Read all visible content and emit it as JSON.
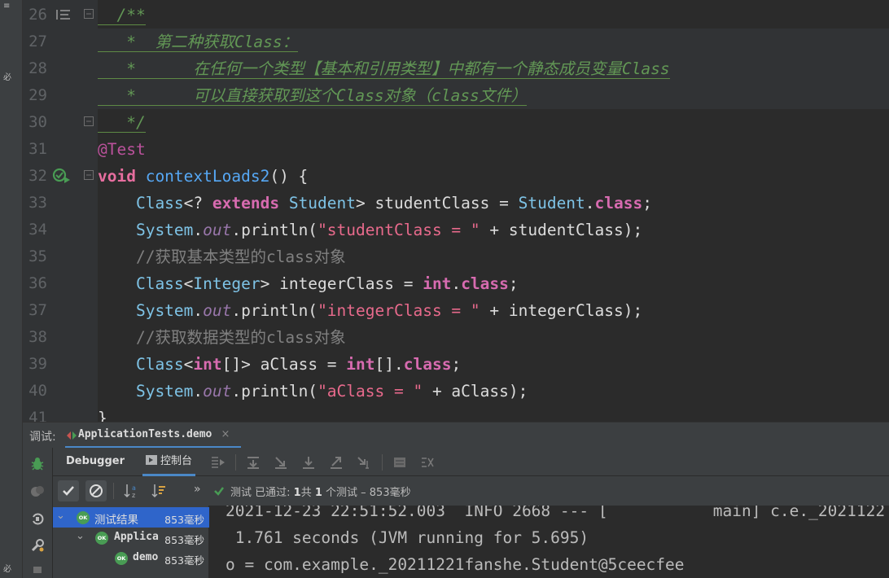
{
  "editor": {
    "lines": [
      {
        "num": "26",
        "segments": [
          {
            "t": "/**",
            "c": "c-doc"
          }
        ]
      },
      {
        "num": "27",
        "segments": [
          {
            "t": " *  第二种获取Class：",
            "c": "c-doc"
          }
        ]
      },
      {
        "num": "28",
        "segments": [
          {
            "t": " *      在任何一个类型【基本和引用类型】中都有一个静态成员变量Class",
            "c": "c-doc"
          }
        ]
      },
      {
        "num": "29",
        "segments": [
          {
            "t": " *      可以直接获取到这个Class对象（class文件）",
            "c": "c-doc"
          }
        ]
      },
      {
        "num": "30",
        "segments": [
          {
            "t": " */",
            "c": "c-doc"
          }
        ]
      },
      {
        "num": "31",
        "segments": [
          {
            "t": "@Test",
            "c": "c-ann"
          }
        ]
      },
      {
        "num": "32",
        "segments": [
          {
            "t": "void ",
            "c": "c-void"
          },
          {
            "t": "contextLoads2",
            "c": "c-method"
          },
          {
            "t": "() {",
            "c": "c-plain"
          }
        ]
      },
      {
        "num": "33",
        "segments": [
          {
            "t": "    Class",
            "c": "c-cls"
          },
          {
            "t": "<? ",
            "c": "c-plain"
          },
          {
            "t": "extends ",
            "c": "c-kwint"
          },
          {
            "t": "Student",
            "c": "c-cls"
          },
          {
            "t": "> studentClass = ",
            "c": "c-plain"
          },
          {
            "t": "Student",
            "c": "c-cls"
          },
          {
            "t": ".",
            "c": "c-plain"
          },
          {
            "t": "class",
            "c": "c-clsfield"
          },
          {
            "t": ";",
            "c": "c-plain"
          }
        ]
      },
      {
        "num": "34",
        "segments": [
          {
            "t": "    System",
            "c": "c-cls"
          },
          {
            "t": ".",
            "c": "c-plain"
          },
          {
            "t": "out",
            "c": "c-field"
          },
          {
            "t": ".println(",
            "c": "c-plain"
          },
          {
            "t": "\"studentClass = \"",
            "c": "c-str"
          },
          {
            "t": " + studentClass);",
            "c": "c-plain"
          }
        ]
      },
      {
        "num": "35",
        "segments": [
          {
            "t": "    //获取基本类型的class对象",
            "c": "c-cmt"
          }
        ]
      },
      {
        "num": "36",
        "segments": [
          {
            "t": "    Class",
            "c": "c-cls"
          },
          {
            "t": "<",
            "c": "c-plain"
          },
          {
            "t": "Integer",
            "c": "c-cls"
          },
          {
            "t": "> integerClass = ",
            "c": "c-plain"
          },
          {
            "t": "int",
            "c": "c-kwint"
          },
          {
            "t": ".",
            "c": "c-plain"
          },
          {
            "t": "class",
            "c": "c-clsfield"
          },
          {
            "t": ";",
            "c": "c-plain"
          }
        ]
      },
      {
        "num": "37",
        "segments": [
          {
            "t": "    System",
            "c": "c-cls"
          },
          {
            "t": ".",
            "c": "c-plain"
          },
          {
            "t": "out",
            "c": "c-field"
          },
          {
            "t": ".println(",
            "c": "c-plain"
          },
          {
            "t": "\"integerClass = \"",
            "c": "c-str"
          },
          {
            "t": " + integerClass);",
            "c": "c-plain"
          }
        ]
      },
      {
        "num": "38",
        "segments": [
          {
            "t": "    //获取数据类型的class对象",
            "c": "c-cmt"
          }
        ]
      },
      {
        "num": "39",
        "segments": [
          {
            "t": "    Class",
            "c": "c-cls"
          },
          {
            "t": "<",
            "c": "c-plain"
          },
          {
            "t": "int",
            "c": "c-kwint"
          },
          {
            "t": "[]> aClass = ",
            "c": "c-plain"
          },
          {
            "t": "int",
            "c": "c-kwint"
          },
          {
            "t": "[].",
            "c": "c-plain"
          },
          {
            "t": "class",
            "c": "c-clsfield"
          },
          {
            "t": ";",
            "c": "c-plain"
          }
        ]
      },
      {
        "num": "40",
        "segments": [
          {
            "t": "    System",
            "c": "c-cls"
          },
          {
            "t": ".",
            "c": "c-plain"
          },
          {
            "t": "out",
            "c": "c-field"
          },
          {
            "t": ".println(",
            "c": "c-plain"
          },
          {
            "t": "\"aClass = \"",
            "c": "c-str"
          },
          {
            "t": " + aClass);",
            "c": "c-plain"
          }
        ]
      },
      {
        "num": "41",
        "segments": [
          {
            "t": "}",
            "c": "c-plain"
          }
        ]
      }
    ]
  },
  "tool_window": {
    "title": "调试:",
    "tab_label": "ApplicationTests.demo",
    "tab_close": "×",
    "debugger_tab": "Debugger",
    "console_tab": "控制台"
  },
  "test_status": {
    "passed_prefix": "测试 已通过: ",
    "passed_count": "1",
    "middle": "共 ",
    "total": "1",
    "suffix": " 个测试 – 853毫秒",
    "overflow": "»"
  },
  "tree": [
    {
      "name": "测试结果",
      "time": "853毫秒",
      "ok": "OK"
    },
    {
      "name": "Applica",
      "time": "853毫秒",
      "ok": "OK"
    },
    {
      "name": "demo",
      "time": "853毫秒",
      "ok": "OK"
    }
  ],
  "console": {
    "lines": [
      "2021-12-23 22:51:52.003  INFO 2668 --- [           main] c.e._2021122",
      " 1.761 seconds (JVM running for 5.695)",
      "o = com.example._20211221fanshe.Student@5ceecfee"
    ]
  },
  "colors": {
    "accent": "#4a88c7",
    "selection": "#2f65ca",
    "ok_green": "#499c54"
  }
}
